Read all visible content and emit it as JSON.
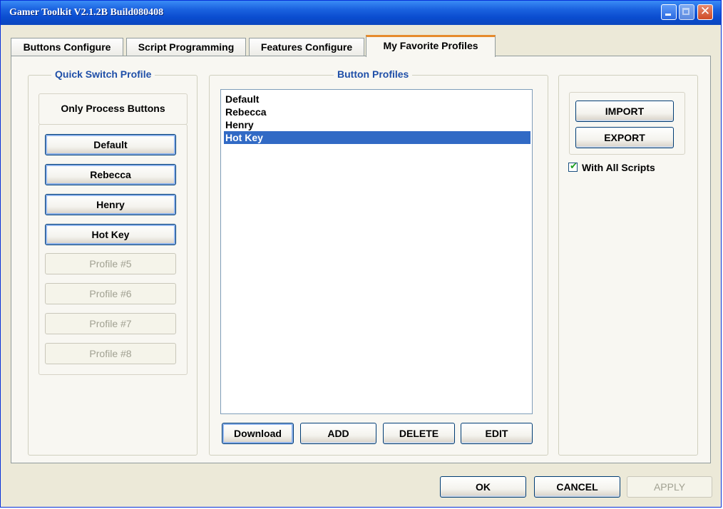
{
  "window": {
    "title": "Gamer Toolkit V2.1.2B Build080408",
    "minimize_glyph": "",
    "maximize_glyph": "",
    "close_glyph": "✕"
  },
  "tabs": [
    {
      "label": "Buttons Configure",
      "active": false
    },
    {
      "label": "Script Programming",
      "active": false
    },
    {
      "label": "Features Configure",
      "active": false
    },
    {
      "label": "My Favorite Profiles",
      "active": true
    }
  ],
  "quick_switch": {
    "group_label": "Quick Switch Profile",
    "only_process_label": "Only Process Buttons",
    "profiles": [
      {
        "label": "Default",
        "enabled": true
      },
      {
        "label": "Rebecca",
        "enabled": true
      },
      {
        "label": "Henry",
        "enabled": true
      },
      {
        "label": "Hot Key",
        "enabled": true
      },
      {
        "label": "Profile #5",
        "enabled": false
      },
      {
        "label": "Profile #6",
        "enabled": false
      },
      {
        "label": "Profile #7",
        "enabled": false
      },
      {
        "label": "Profile #8",
        "enabled": false
      }
    ]
  },
  "button_profiles": {
    "group_label": "Button Profiles",
    "items": [
      "Default",
      "Rebecca",
      "Henry",
      "Hot Key"
    ],
    "selected_index": 3,
    "download_label": "Download",
    "add_label": "ADD",
    "delete_label": "DELETE",
    "edit_label": "EDIT"
  },
  "import_export": {
    "import_label": "IMPORT",
    "export_label": "EXPORT",
    "with_all_scripts_label": "With All Scripts",
    "with_all_scripts_checked": true,
    "check_glyph": "✔"
  },
  "footer": {
    "ok_label": "OK",
    "cancel_label": "CANCEL",
    "apply_label": "APPLY"
  },
  "colors": {
    "title_bar": "#0a4ccf",
    "group_label": "#1f4fa8",
    "selection": "#316ac5",
    "active_tab_accent": "#e68b2c"
  }
}
